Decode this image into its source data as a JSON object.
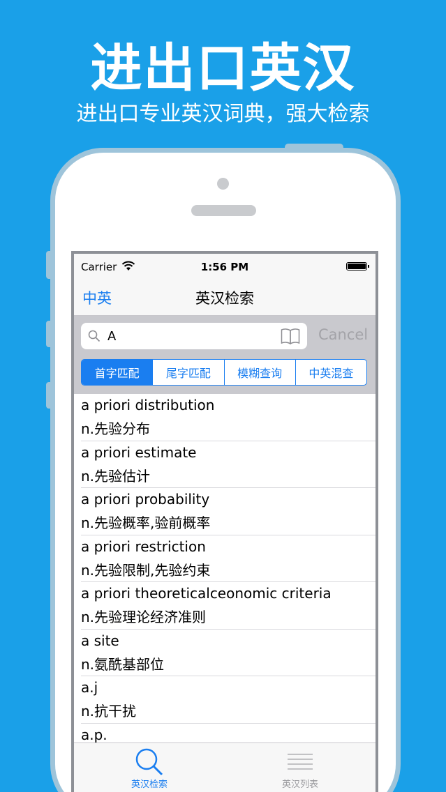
{
  "hero": {
    "title": "进出口英汉",
    "subtitle": "进出口专业英汉词典，强大检索"
  },
  "status_bar": {
    "carrier": "Carrier",
    "time": "1:56 PM"
  },
  "nav": {
    "left_button": "中英",
    "title": "英汉检索"
  },
  "search": {
    "value": "A",
    "placeholder": "",
    "cancel_label": "Cancel"
  },
  "segments": [
    {
      "label": "首字匹配",
      "selected": true
    },
    {
      "label": "尾字匹配",
      "selected": false
    },
    {
      "label": "模糊查询",
      "selected": false
    },
    {
      "label": "中英混查",
      "selected": false
    }
  ],
  "results": [
    {
      "word": "a priori distribution",
      "meaning": "n.先验分布"
    },
    {
      "word": "a priori estimate",
      "meaning": "n.先验估计"
    },
    {
      "word": "a priori probability",
      "meaning": "n.先验概率,验前概率"
    },
    {
      "word": "a priori restriction",
      "meaning": "n.先验限制,先验约束"
    },
    {
      "word": "a priori theoreticalceonomic criteria",
      "meaning": "n.先验理论经济准则"
    },
    {
      "word": "a site",
      "meaning": "n.氨酰基部位"
    },
    {
      "word": "a.j",
      "meaning": "n.抗干扰"
    },
    {
      "word": "a.p.",
      "meaning": ""
    }
  ],
  "tab_bar": {
    "tabs": [
      {
        "label": "英汉检索",
        "icon": "search-icon",
        "active": true
      },
      {
        "label": "英汉列表",
        "icon": "list-icon",
        "active": false
      }
    ]
  },
  "colors": {
    "background": "#1aa0e8",
    "accent": "#1a7ef0"
  }
}
